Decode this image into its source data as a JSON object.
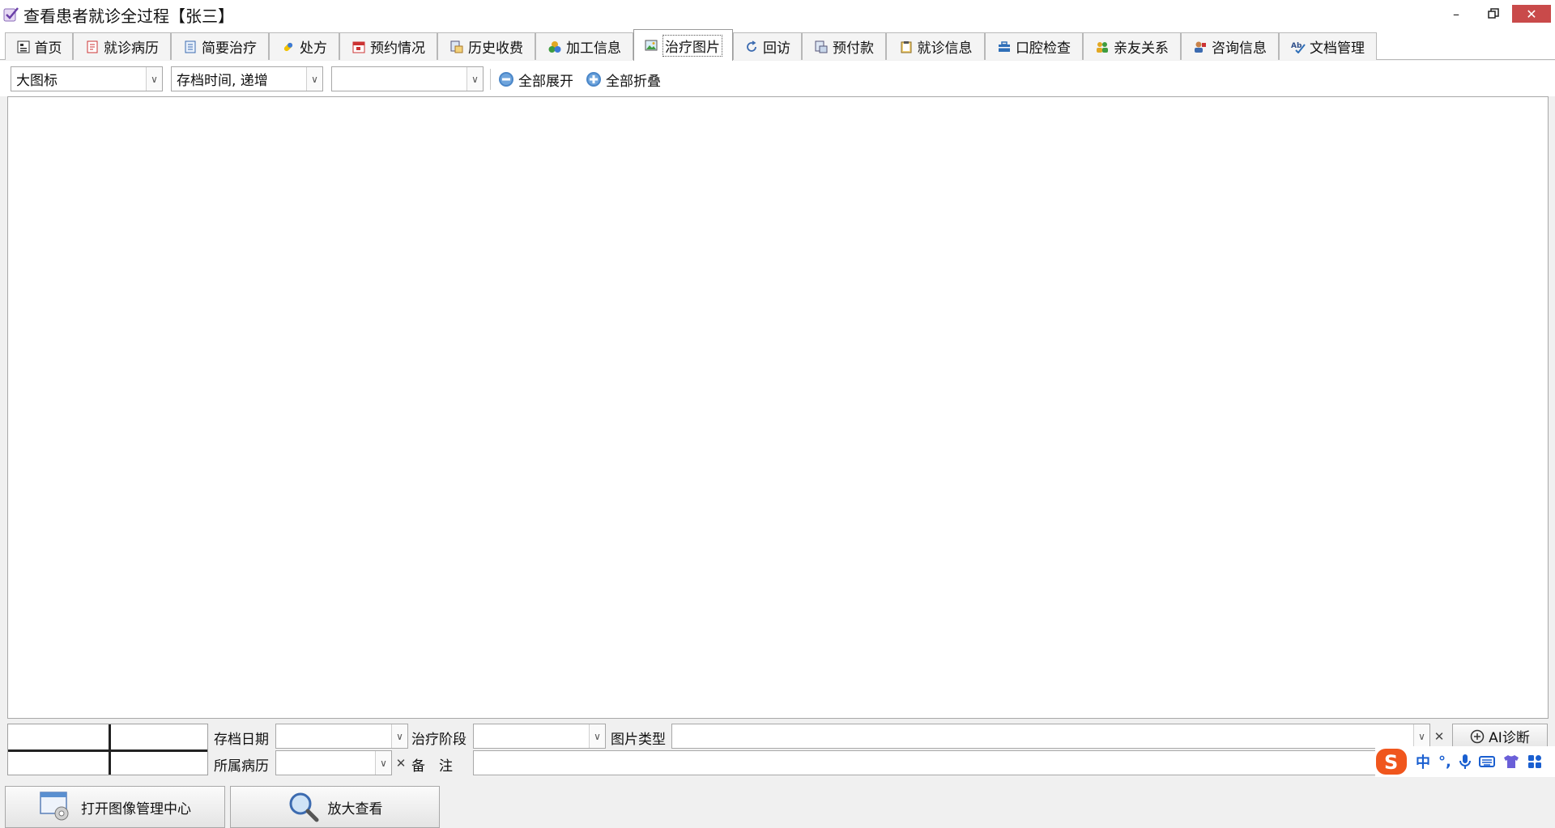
{
  "window": {
    "title": "查看患者就诊全过程【张三】",
    "min_symbol": "–",
    "max_symbol": "🗗",
    "close_symbol": "✕"
  },
  "tabs": [
    {
      "label": "首页",
      "icon": "home-icon"
    },
    {
      "label": "就诊病历",
      "icon": "medical-record-icon"
    },
    {
      "label": "简要治疗",
      "icon": "document-icon"
    },
    {
      "label": "处方",
      "icon": "pill-icon"
    },
    {
      "label": "预约情况",
      "icon": "calendar-icon"
    },
    {
      "label": "历史收费",
      "icon": "billing-icon"
    },
    {
      "label": "加工信息",
      "icon": "processing-icon"
    },
    {
      "label": "治疗图片",
      "icon": "image-icon",
      "active": true
    },
    {
      "label": "回访",
      "icon": "refresh-icon"
    },
    {
      "label": "预付款",
      "icon": "prepay-icon"
    },
    {
      "label": "就诊信息",
      "icon": "clipboard-icon"
    },
    {
      "label": "口腔检查",
      "icon": "briefcase-icon"
    },
    {
      "label": "亲友关系",
      "icon": "people-icon"
    },
    {
      "label": "咨询信息",
      "icon": "consult-icon"
    },
    {
      "label": "文档管理",
      "icon": "spellcheck-icon"
    }
  ],
  "toolbar": {
    "view_mode": "大图标",
    "sort_order": "存档时间, 递增",
    "filter_value": "",
    "expand_all_label": "全部展开",
    "collapse_all_label": "全部折叠"
  },
  "info_panel": {
    "archive_date_label": "存档日期",
    "archive_date_value": "",
    "treatment_stage_label": "治疗阶段",
    "treatment_stage_value": "",
    "image_type_label": "图片类型",
    "image_type_value": "",
    "ai_button_label": "AI诊断",
    "record_label": "所属病历",
    "record_value": "",
    "remark_label": "备　注",
    "remark_value": "",
    "clear_symbol": "✕"
  },
  "actions": {
    "open_image_center_label": "打开图像管理中心",
    "zoom_view_label": "放大查看"
  },
  "ime": {
    "logo": "S",
    "lang": "中",
    "punct": "°,"
  },
  "colors": {
    "close_button": "#c94a4a",
    "ime_blue": "#1a5fd0",
    "ime_logo": "#f0561d"
  }
}
